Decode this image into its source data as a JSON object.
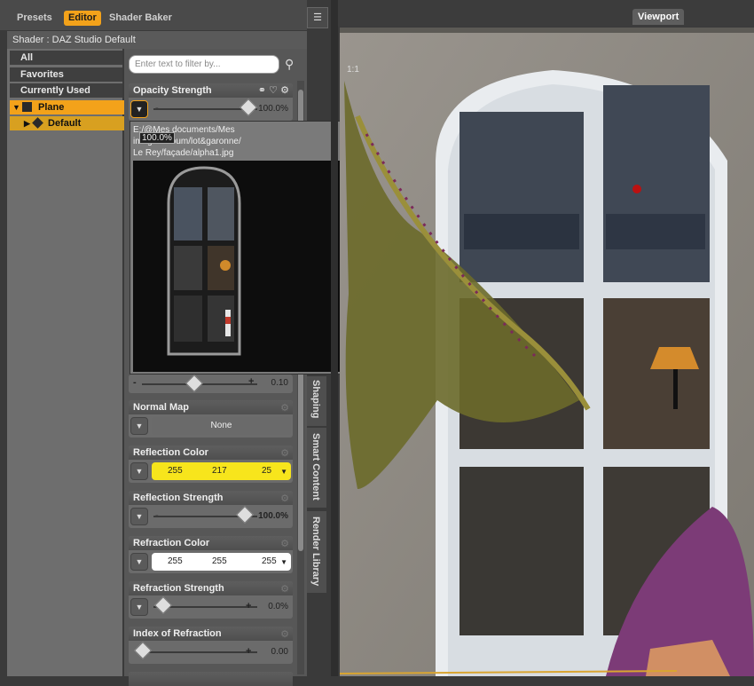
{
  "tabs": [
    {
      "label": "Presets",
      "active": false
    },
    {
      "label": "Editor",
      "active": true
    },
    {
      "label": "Shader Baker",
      "active": false
    }
  ],
  "shader_header": "Shader : DAZ Studio Default",
  "tree": {
    "categories": [
      "All",
      "Favorites",
      "Currently Used"
    ],
    "nodes": [
      {
        "label": "Plane",
        "expanded": true
      },
      {
        "label": "Default",
        "expanded": false
      }
    ]
  },
  "filter": {
    "placeholder": "Enter text to filter by..."
  },
  "properties": {
    "opacity": {
      "label": "Opacity Strength",
      "value": "100.0%",
      "level": 1.0
    },
    "top_slider": {
      "value": "0.10",
      "level": 0.1
    },
    "normal_map": {
      "label": "Normal Map",
      "value": "None"
    },
    "reflection_color": {
      "label": "Reflection Color",
      "r": "255",
      "g": "217",
      "b": "25"
    },
    "reflection_strength": {
      "label": "Reflection Strength",
      "value": "100.0%",
      "level": 1.0
    },
    "refraction_color": {
      "label": "Refraction Color",
      "r": "255",
      "g": "255",
      "b": "255"
    },
    "refraction_strength": {
      "label": "Refraction Strength",
      "value": "0.0%",
      "level": 0.0
    },
    "index_of_refraction": {
      "label": "Index of Refraction",
      "value": "0.00",
      "level": 0.0
    }
  },
  "side_tabs": [
    "Shaping",
    "Smart Content",
    "Render Library"
  ],
  "tooltip": {
    "path": "E:/@Mes documents/Mes\nimages/album/lot&garonne/\nLe Rey/façade/alpha1.jpg",
    "badge": "100.0%"
  },
  "viewport": {
    "tab": "Viewport",
    "label": "1:1"
  },
  "colors": {
    "accent": "#f3a21a",
    "reflection_swatch": "#f7e51c"
  }
}
